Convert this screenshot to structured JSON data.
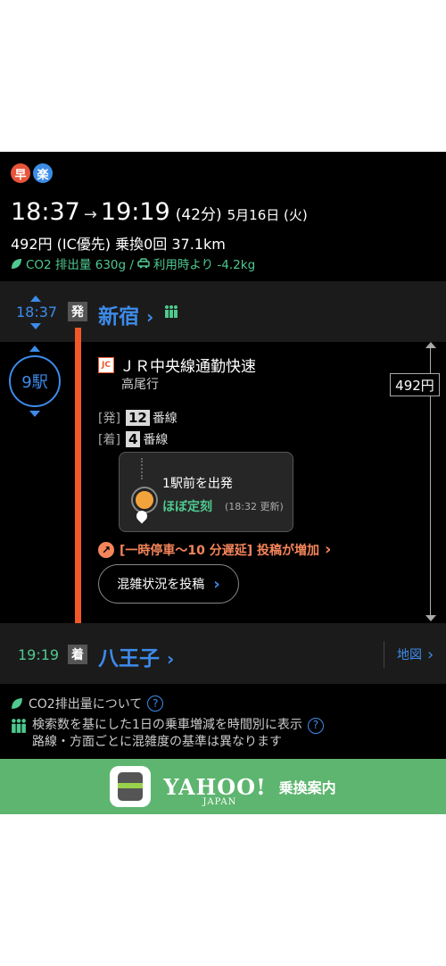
{
  "summary": {
    "badges": [
      {
        "label": "早",
        "color": "#e8543a"
      },
      {
        "label": "楽",
        "color": "#3b8de6"
      }
    ],
    "dep_time": "18:37",
    "arr_time": "19:19",
    "duration": "(42分)",
    "date": "5月16日 (火)",
    "fare_info": "492円 (IC優先) 乗換0回 37.1km",
    "co2": "CO2 排出量 630g / ",
    "co2_car": "利用時より -4.2kg"
  },
  "departure": {
    "time": "18:37",
    "tag": "発",
    "station": "新宿",
    "chevron": "›"
  },
  "segment": {
    "stops": "9駅",
    "line_logo": "JC",
    "line_name": "ＪＲ中央線通勤快速",
    "destination": "高尾行",
    "dep_platform_label": "[発]",
    "dep_platform_num": "12",
    "dep_platform_suffix": "番線",
    "arr_platform_label": "[着]",
    "arr_platform_num": "4",
    "arr_platform_suffix": "番線",
    "status_position": "1駅前を出発",
    "status_text": "ほぼ定刻",
    "status_updated": "(18:32 更新)",
    "delay_report": "[一時停車〜10 分遅延] 投稿が増加",
    "delay_chevron": "›",
    "post_button": "混雑状況を投稿",
    "post_chevron": "›",
    "fare": "492円"
  },
  "arrival": {
    "time": "19:19",
    "tag": "着",
    "station": "八王子",
    "chevron": "›",
    "map_label": "地図",
    "map_chevron": "›"
  },
  "info": {
    "co2_about": "CO2排出量について",
    "congestion_line1": "検索数を基にした1日の乗車増減を時間別に表示",
    "congestion_line2": "路線・方面ごとに混雑度の基準は異なります",
    "help": "?"
  },
  "footer": {
    "brand": "YAHOO!",
    "brand_sub": "JAPAN",
    "service": "乗換案内"
  },
  "colors": {
    "accent": "#3d8bea",
    "line": "#f0582a",
    "green": "#4fc98f",
    "footer": "#5eb56f"
  }
}
